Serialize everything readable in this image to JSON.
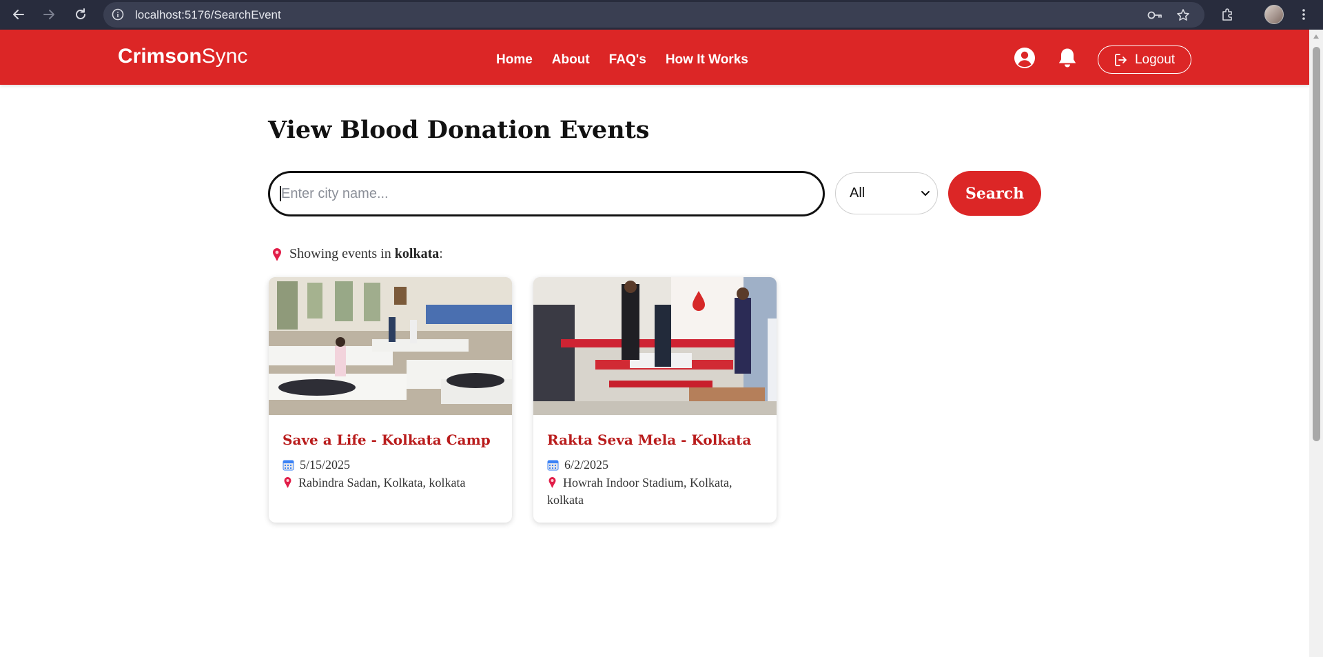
{
  "browser": {
    "url": "localhost:5176/SearchEvent"
  },
  "header": {
    "logo_bold": "Crimson",
    "logo_regular": "Sync",
    "nav": [
      {
        "label": "Home"
      },
      {
        "label": "About"
      },
      {
        "label": "FAQ's"
      },
      {
        "label": "How It Works"
      }
    ],
    "logout_label": "Logout",
    "icons": [
      "user-circle-icon",
      "bell-icon",
      "logout-icon"
    ],
    "brand_color": "#dc2626"
  },
  "main": {
    "title": "View Blood Donation Events",
    "search": {
      "placeholder": "Enter city name...",
      "value": ""
    },
    "filter_selected": "All",
    "search_button": "Search",
    "results": {
      "prefix": "Showing events in ",
      "city": "kolkata",
      "suffix": ":"
    },
    "events": [
      {
        "title": "Save a Life - Kolkata Camp",
        "date": "5/15/2025",
        "location": "Rabindra Sadan, Kolkata, kolkata"
      },
      {
        "title": "Rakta Seva Mela - Kolkata",
        "date": "6/2/2025",
        "location": "Howrah Indoor Stadium, Kolkata, kolkata"
      }
    ]
  }
}
